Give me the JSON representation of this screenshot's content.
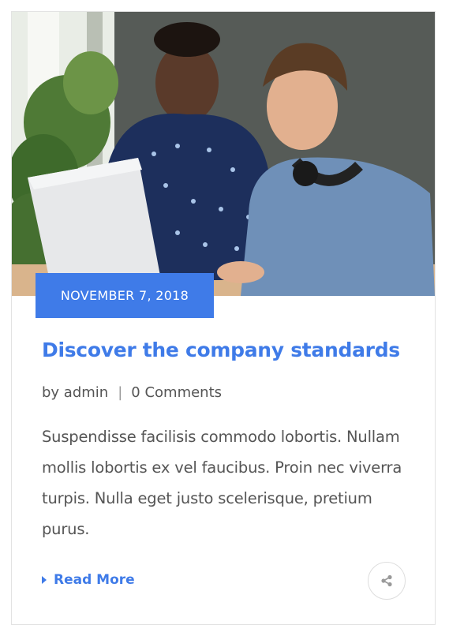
{
  "post": {
    "date": "NOVEMBER 7, 2018",
    "title": "Discover the company standards",
    "author": "by admin",
    "separator": "|",
    "comments": "0 Comments",
    "excerpt": "Suspendisse facilisis commodo lobortis. Nullam mollis lobortis ex vel faucibus. Proin nec viverra turpis. Nulla eget justo scelerisque, pretium purus.",
    "read_more": "Read More"
  },
  "icons": {
    "share": "share-icon",
    "read_more": "caret-right-icon"
  },
  "colors": {
    "accent": "#3f7be8",
    "text": "#555555",
    "border": "#e3e3e3"
  }
}
